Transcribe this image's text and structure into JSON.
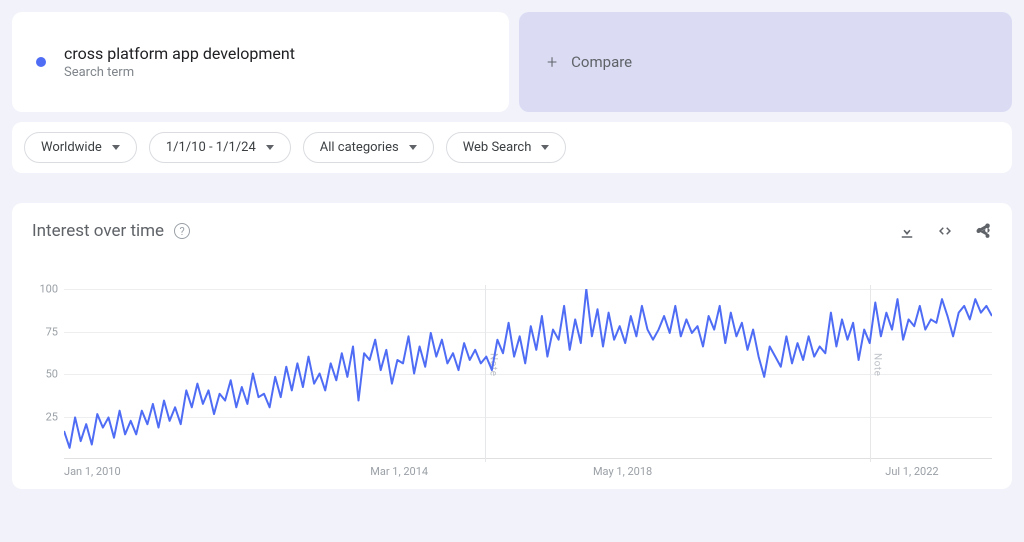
{
  "term": {
    "name": "cross platform app development",
    "subtitle": "Search term",
    "color": "#4f6cf5"
  },
  "compare": {
    "label": "Compare"
  },
  "filters": {
    "region": "Worldwide",
    "daterange": "1/1/10 - 1/1/24",
    "category": "All categories",
    "searchtype": "Web Search"
  },
  "chart": {
    "title": "Interest over time",
    "ylabel_ticks": [
      25,
      50,
      75,
      100
    ],
    "x_ticks": [
      "Jan 1, 2010",
      "Mar 1, 2014",
      "May 1, 2018",
      "Jul 1, 2022"
    ],
    "note_label": "Note"
  },
  "chart_data": {
    "type": "line",
    "title": "Interest over time",
    "xlabel": "",
    "ylabel": "",
    "ylim": [
      0,
      100
    ],
    "x_range": [
      "2010-01-01",
      "2024-01-01"
    ],
    "x_tick_labels": [
      "Jan 1, 2010",
      "Mar 1, 2014",
      "May 1, 2018",
      "Jul 1, 2022"
    ],
    "series": [
      {
        "name": "cross platform app development",
        "color": "#4f6cf5",
        "values": [
          16,
          6,
          24,
          10,
          20,
          8,
          26,
          18,
          24,
          12,
          28,
          14,
          22,
          14,
          28,
          20,
          32,
          18,
          34,
          22,
          30,
          20,
          40,
          30,
          44,
          32,
          40,
          26,
          38,
          34,
          46,
          30,
          42,
          32,
          50,
          36,
          38,
          30,
          48,
          36,
          54,
          40,
          56,
          42,
          60,
          44,
          50,
          40,
          56,
          46,
          62,
          48,
          66,
          34,
          62,
          58,
          70,
          52,
          64,
          44,
          58,
          56,
          72,
          50,
          66,
          54,
          74,
          60,
          70,
          56,
          62,
          52,
          68,
          58,
          64,
          56,
          60,
          52,
          70,
          62,
          80,
          60,
          72,
          56,
          78,
          64,
          84,
          60,
          76,
          70,
          90,
          64,
          82,
          68,
          100,
          72,
          88,
          66,
          86,
          70,
          78,
          68,
          84,
          72,
          90,
          76,
          70,
          76,
          84,
          74,
          90,
          72,
          82,
          74,
          78,
          66,
          84,
          76,
          90,
          68,
          86,
          72,
          80,
          64,
          76,
          60,
          48,
          66,
          60,
          54,
          72,
          56,
          68,
          58,
          72,
          60,
          66,
          62,
          86,
          66,
          82,
          70,
          80,
          58,
          76,
          68,
          92,
          72,
          86,
          76,
          94,
          70,
          82,
          78,
          90,
          76,
          82,
          80,
          94,
          84,
          72,
          86,
          90,
          82,
          94,
          86,
          90,
          84
        ]
      }
    ],
    "annotations": [
      {
        "type": "vline",
        "label": "Note",
        "x_fraction": 0.454
      },
      {
        "type": "vline",
        "label": "Note",
        "x_fraction": 0.868
      }
    ]
  }
}
